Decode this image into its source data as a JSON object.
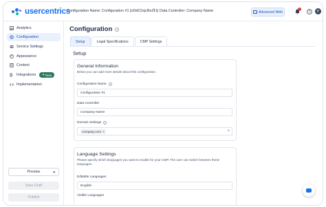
{
  "app": {
    "logo_text": "usercentrics"
  },
  "header": {
    "breadcrumb_config": "Configuration Name: Configuration #1 [nDdC0zjcBeZLt]",
    "breadcrumb_sep": ">",
    "breadcrumb_controller": "Data Controller: Company Name",
    "advanced_button": "Advanced Web",
    "notification_icon": "bell-icon",
    "help_icon": "question-icon",
    "avatar_initial": "P",
    "accent_color": "#1a73e8"
  },
  "sidebar": {
    "items": [
      {
        "label": "Analytics",
        "icon": "analytics-icon",
        "active": false
      },
      {
        "label": "Configuration",
        "icon": "configuration-icon",
        "active": true
      },
      {
        "label": "Service Settings",
        "icon": "service-settings-icon",
        "active": false
      },
      {
        "label": "Appearance",
        "icon": "appearance-icon",
        "active": false
      },
      {
        "label": "Content",
        "icon": "content-icon",
        "active": false
      },
      {
        "label": "Integrations",
        "icon": "integrations-icon",
        "active": false,
        "badge": "New"
      },
      {
        "label": "Implementation",
        "icon": "implementation-icon",
        "active": false
      }
    ],
    "preview_label": "Preview",
    "save_draft_label": "Save Draft",
    "publish_label": "Publish"
  },
  "main": {
    "title": "Configuration",
    "tabs": [
      {
        "label": "Setup",
        "active": true
      },
      {
        "label": "Legal Specifications",
        "active": false
      },
      {
        "label": "CMP Settings",
        "active": false
      }
    ],
    "section_title": "Setup",
    "general": {
      "title": "General Information",
      "subtitle": "Below you can add more details about this configuration.",
      "config_name_label": "Configuration Name",
      "config_name_value": "Configuration #1",
      "data_controller_label": "Data Controller",
      "data_controller_value": "Company Name",
      "domain_settings_label": "Domain Settings",
      "domain_chip": "company.com"
    },
    "language": {
      "title": "Language Settings",
      "subtitle_line1": "Please specify which languages you want to enable for your CMP. The user can switch between these",
      "subtitle_line2": "languages.",
      "editable_label": "Editable Languages",
      "editable_value": "English",
      "visible_label": "Visible Languages"
    }
  }
}
